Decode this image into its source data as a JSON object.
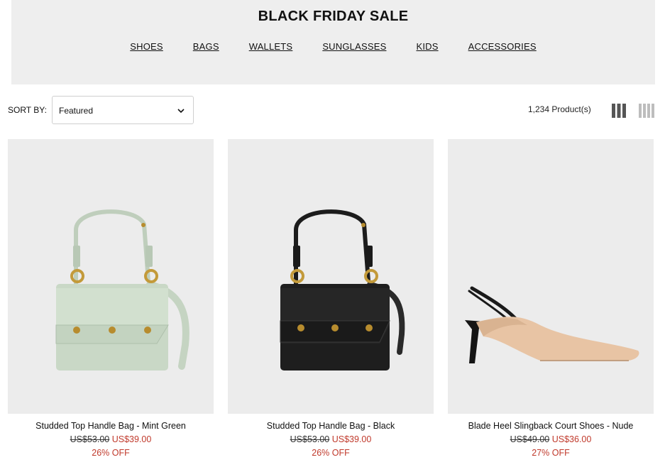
{
  "banner": {
    "title": "BLACK FRIDAY SALE",
    "nav": [
      "SHOES",
      "BAGS",
      "WALLETS",
      "SUNGLASSES",
      "KIDS",
      "ACCESSORIES"
    ]
  },
  "toolbar": {
    "sort_label": "SORT BY:",
    "sort_value": "Featured",
    "product_count": "1,234 Product(s)"
  },
  "products": [
    {
      "name": "Studded Top Handle Bag - Mint Green",
      "old_price": "US$53.00",
      "new_price": "US$39.00",
      "discount": "26% OFF",
      "image_icon": "handbag-mint-green"
    },
    {
      "name": "Studded Top Handle Bag - Black",
      "old_price": "US$53.00",
      "new_price": "US$39.00",
      "discount": "26% OFF",
      "image_icon": "handbag-black"
    },
    {
      "name": "Blade Heel Slingback Court Shoes - Nude",
      "old_price": "US$49.00",
      "new_price": "US$36.00",
      "discount": "27% OFF",
      "image_icon": "slingback-shoe-nude"
    }
  ],
  "colors": {
    "banner_bg": "#eeeeee",
    "sale_red": "#c0392b",
    "image_bg": "#ececec",
    "mint": "#c9d8c6",
    "nude": "#e8c4a4"
  }
}
